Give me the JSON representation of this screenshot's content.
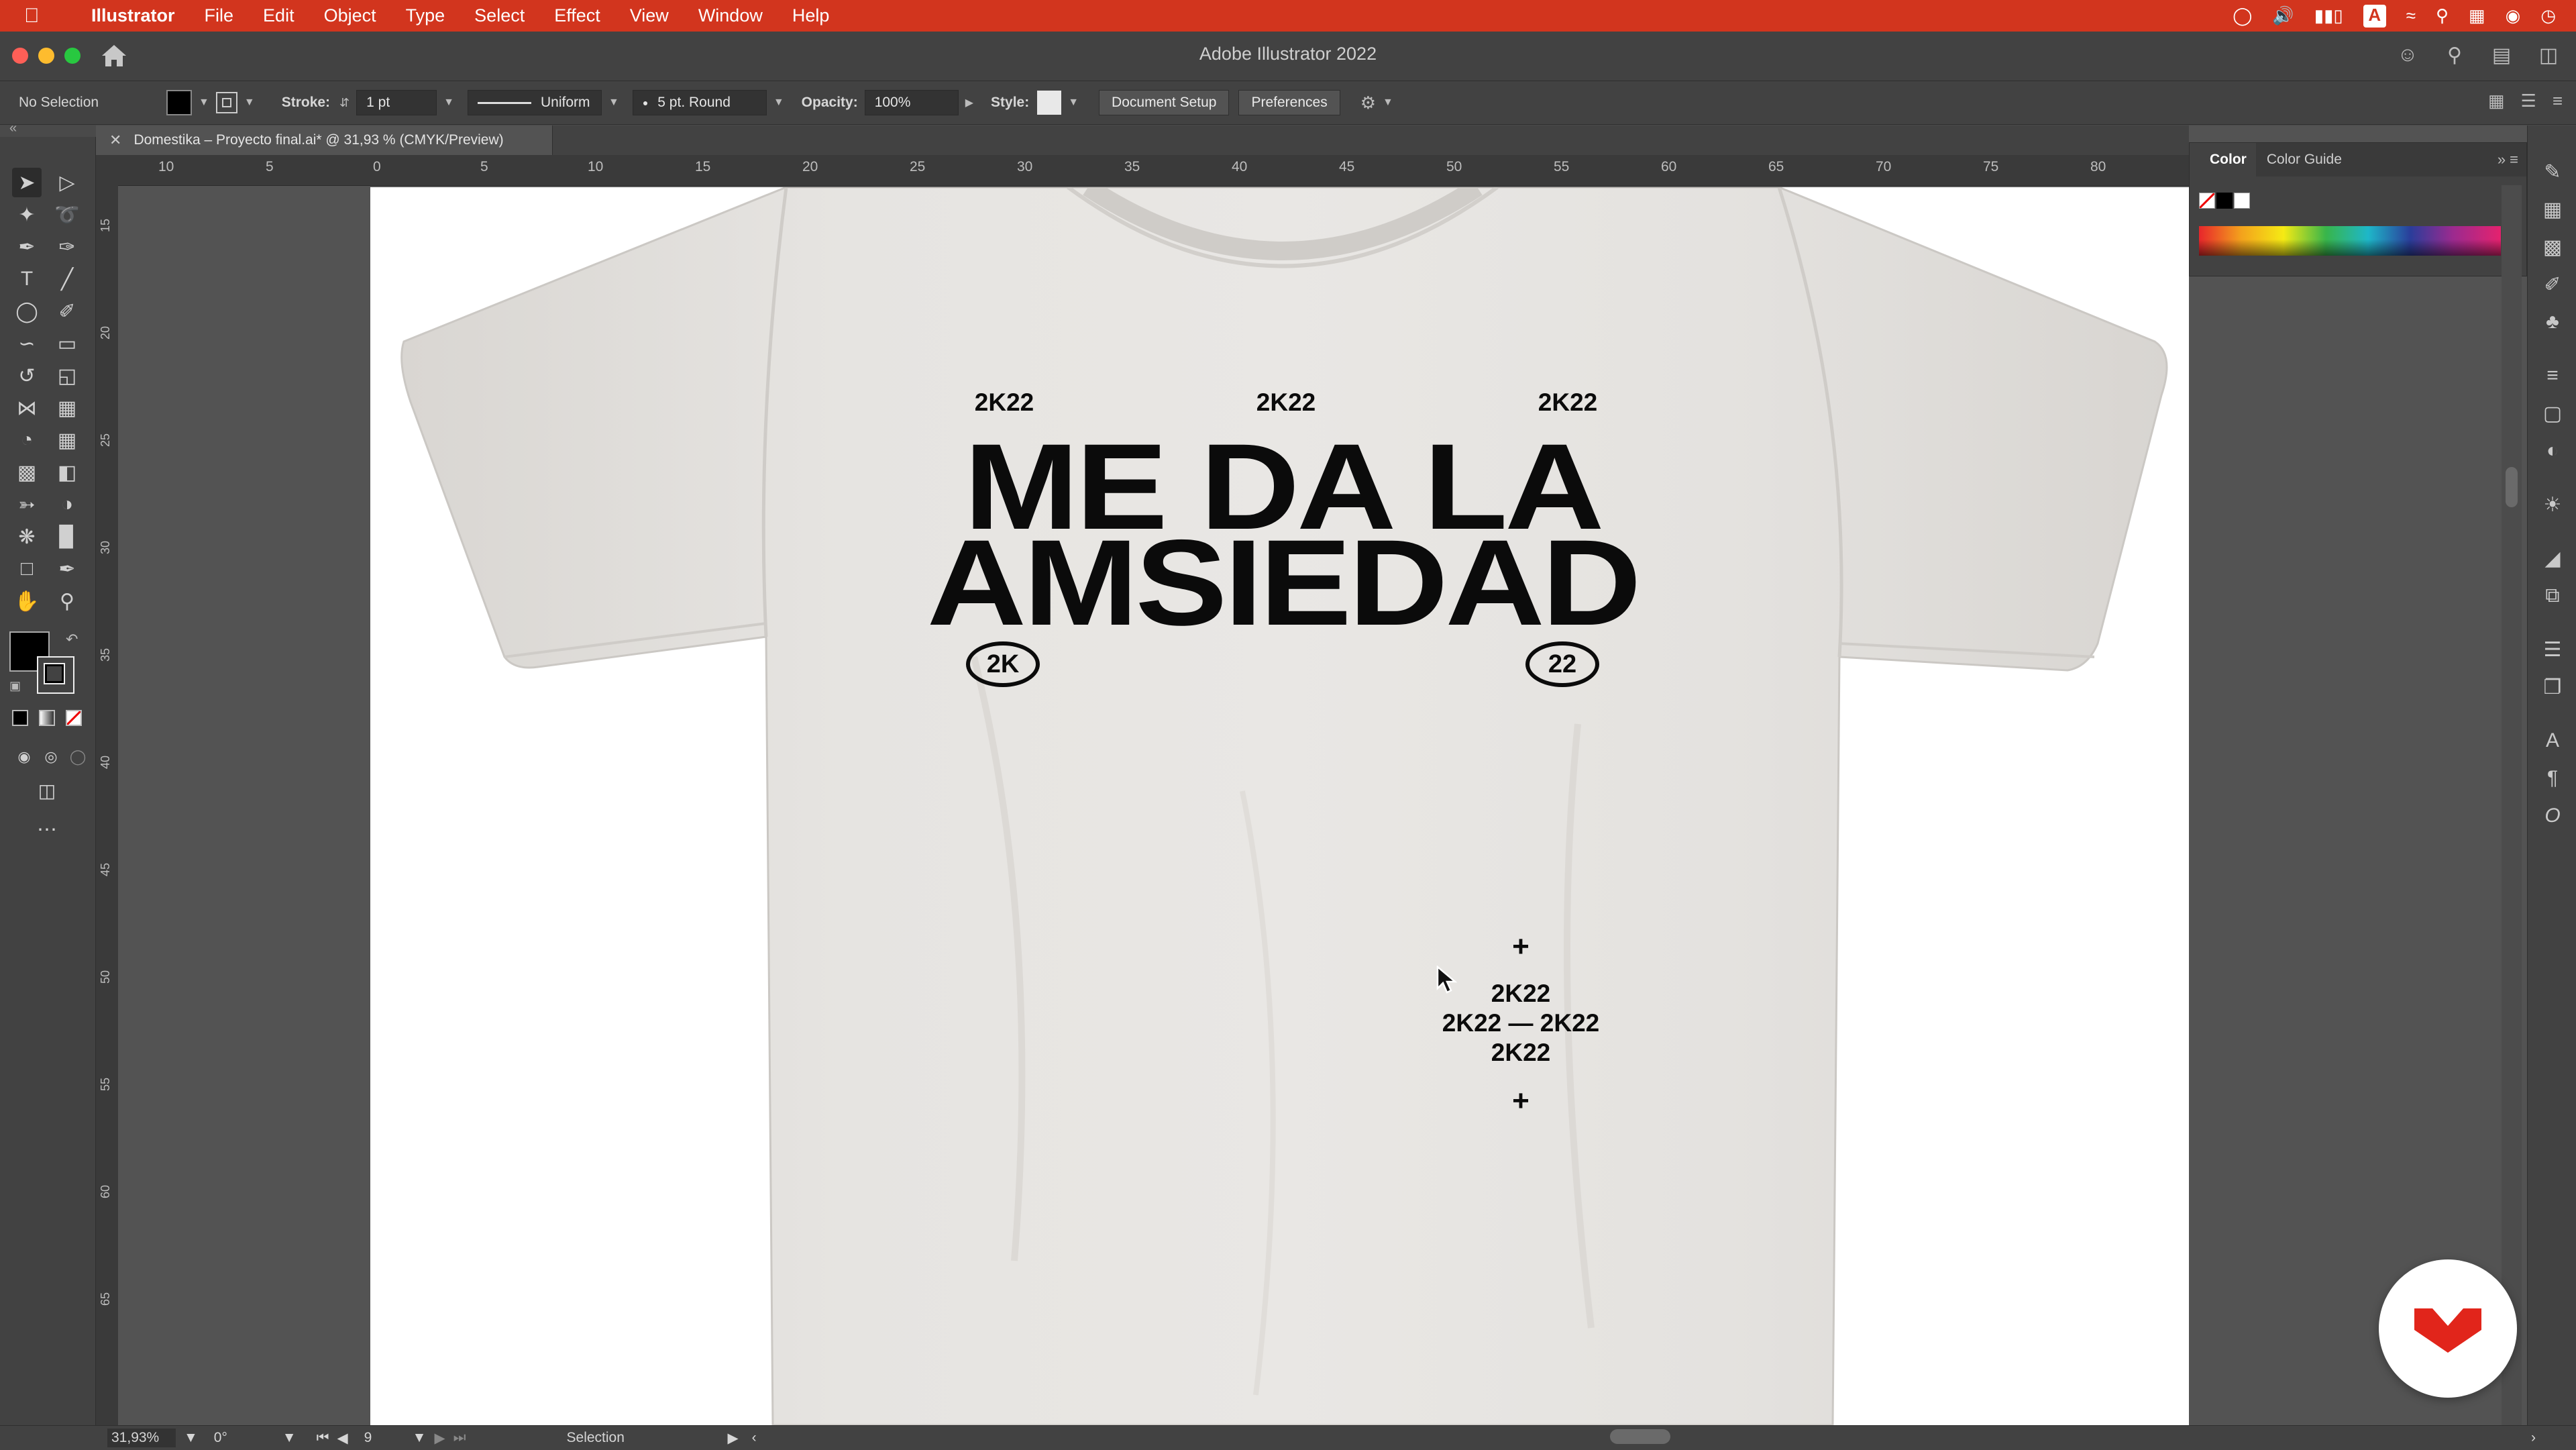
{
  "menubar": {
    "app": "Illustrator",
    "items": [
      "File",
      "Edit",
      "Object",
      "Type",
      "Select",
      "Effect",
      "View",
      "Window",
      "Help"
    ]
  },
  "window": {
    "title": "Adobe Illustrator 2022"
  },
  "control_bar": {
    "selection": "No Selection",
    "stroke_label": "Stroke:",
    "stroke_weight": "1 pt",
    "stroke_profile": "Uniform",
    "brush": "5 pt. Round",
    "opacity_label": "Opacity:",
    "opacity": "100%",
    "style_label": "Style:",
    "document_setup": "Document Setup",
    "preferences": "Preferences"
  },
  "document_tab": {
    "title": "Domestika – Proyecto final.ai* @ 31,93 % (CMYK/Preview)"
  },
  "ruler": {
    "top_labels": [
      "10",
      "5",
      "0",
      "5",
      "10",
      "15",
      "20",
      "25",
      "30",
      "35",
      "40",
      "45",
      "50",
      "55",
      "60",
      "65",
      "70",
      "75",
      "80"
    ],
    "left_labels": [
      "15",
      "20",
      "25",
      "30",
      "35",
      "40",
      "45",
      "50",
      "55",
      "60",
      "65"
    ]
  },
  "artwork": {
    "top_tags": [
      "2K22",
      "2K22",
      "2K22"
    ],
    "headline_line1": "ME DA LA",
    "headline_line2": "AMSIEDAD",
    "pill_left": "2K",
    "pill_right": "22",
    "plus": "+",
    "stack_line1": "2K22",
    "stack_line2": "2K22 — 2K22",
    "stack_line3": "2K22"
  },
  "color_panel": {
    "tab_active": "Color",
    "tab_other": "Color Guide"
  },
  "statusbar": {
    "zoom": "31,93%",
    "rotation": "0°",
    "artboard": "9",
    "tool": "Selection"
  },
  "colors": {
    "menubar_bg": "#d2351e",
    "ui_dark": "#424242",
    "canvas_bg": "#535353",
    "shirt": "#e4e2df",
    "ink": "#0b0b0b",
    "brand_red": "#e1251b"
  }
}
